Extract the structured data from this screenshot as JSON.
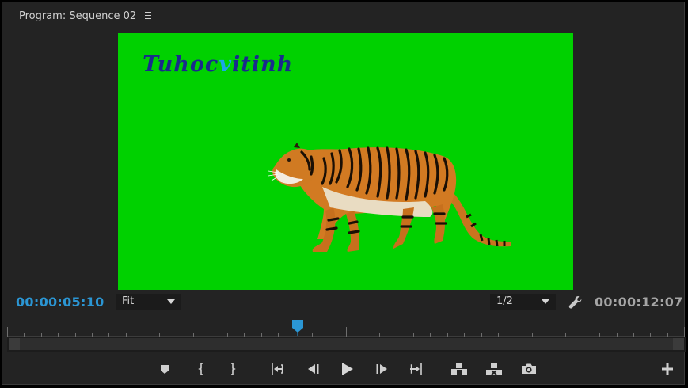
{
  "panel": {
    "title": "Program: Sequence 02",
    "menu_icon": "hamburger-menu-icon"
  },
  "viewer": {
    "watermark_part1": "Tuhoc",
    "watermark_accent": "v",
    "watermark_part2": "itinh",
    "background_color": "#00d100",
    "subject": "tiger"
  },
  "timecode": {
    "current": "00:00:05:10",
    "duration": "00:00:12:07",
    "current_color": "#2b96d4"
  },
  "zoom_select": {
    "value": "Fit"
  },
  "resolution_select": {
    "value": "1/2"
  },
  "settings_icon": "wrench-icon",
  "transport": [
    {
      "name": "add-marker-button",
      "icon": "marker-icon"
    },
    {
      "name": "mark-in-button",
      "icon": "mark-in-icon"
    },
    {
      "name": "mark-out-button",
      "icon": "mark-out-icon"
    },
    {
      "name": "go-to-in-button",
      "icon": "go-to-in-icon"
    },
    {
      "name": "step-back-button",
      "icon": "step-back-icon"
    },
    {
      "name": "play-button",
      "icon": "play-icon"
    },
    {
      "name": "step-forward-button",
      "icon": "step-forward-icon"
    },
    {
      "name": "go-to-out-button",
      "icon": "go-to-out-icon"
    },
    {
      "name": "lift-button",
      "icon": "lift-icon"
    },
    {
      "name": "extract-button",
      "icon": "extract-icon"
    },
    {
      "name": "export-frame-button",
      "icon": "camera-icon"
    },
    {
      "name": "button-editor-button",
      "icon": "plus-icon"
    }
  ]
}
